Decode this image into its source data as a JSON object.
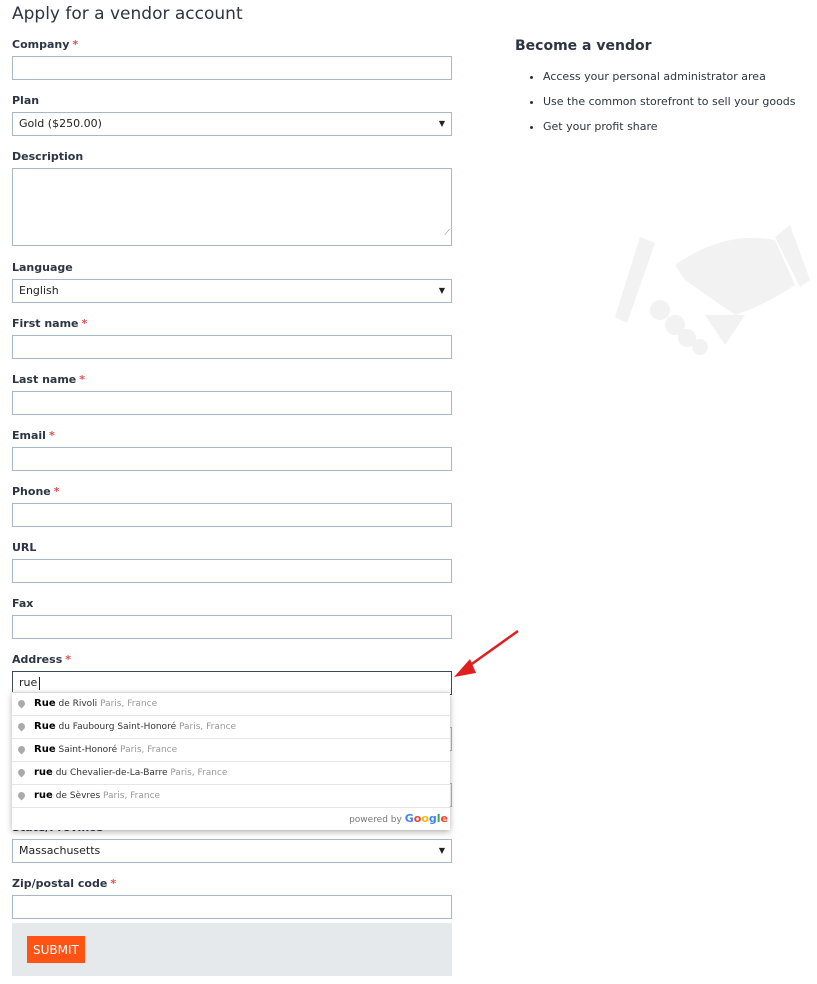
{
  "page_title": "Apply for a vendor account",
  "fields": [
    {
      "label": "Company",
      "required": true,
      "type": "text",
      "value": ""
    },
    {
      "label": "Plan",
      "required": false,
      "type": "select",
      "value": "Gold ($250.00)"
    },
    {
      "label": "Description",
      "required": false,
      "type": "textarea",
      "value": ""
    },
    {
      "label": "Language",
      "required": false,
      "type": "select",
      "value": "English"
    },
    {
      "label": "First name",
      "required": true,
      "type": "text",
      "value": ""
    },
    {
      "label": "Last name",
      "required": true,
      "type": "text",
      "value": ""
    },
    {
      "label": "Email",
      "required": true,
      "type": "text",
      "value": ""
    },
    {
      "label": "Phone",
      "required": true,
      "type": "text",
      "value": ""
    },
    {
      "label": "URL",
      "required": false,
      "type": "text",
      "value": ""
    },
    {
      "label": "Fax",
      "required": false,
      "type": "text",
      "value": ""
    },
    {
      "label": "Address",
      "required": true,
      "type": "text",
      "value": "rue",
      "focused": true
    },
    {
      "label": "",
      "required": false,
      "type": "text",
      "value": ""
    },
    {
      "label": "",
      "required": false,
      "type": "text",
      "value": ""
    },
    {
      "label": "State/Province",
      "required": true,
      "type": "select",
      "value": "Massachusetts"
    },
    {
      "label": "Zip/postal code",
      "required": true,
      "type": "text",
      "value": ""
    }
  ],
  "autocomplete": {
    "suggestions": [
      {
        "match": "Rue",
        "rest": "de Rivoli",
        "secondary": "Paris, France"
      },
      {
        "match": "Rue",
        "rest": "du Faubourg Saint-Honoré",
        "secondary": "Paris, France"
      },
      {
        "match": "Rue",
        "rest": "Saint-Honoré",
        "secondary": "Paris, France"
      },
      {
        "match": "rue",
        "rest": "du Chevalier-de-La-Barre",
        "secondary": "Paris, France"
      },
      {
        "match": "rue",
        "rest": "de Sèvres",
        "secondary": "Paris, France"
      }
    ],
    "powered_by": "powered by",
    "google_logo": "Google"
  },
  "submit_label": "SUBMIT",
  "sidebar": {
    "title": "Become a vendor",
    "items": [
      "Access your personal administrator area",
      "Use the common storefront to sell your goods",
      "Get your profit share"
    ]
  },
  "colors": {
    "accent": "#ff5215",
    "required": "#e24d4d",
    "annotation_arrow": "#e02020"
  }
}
